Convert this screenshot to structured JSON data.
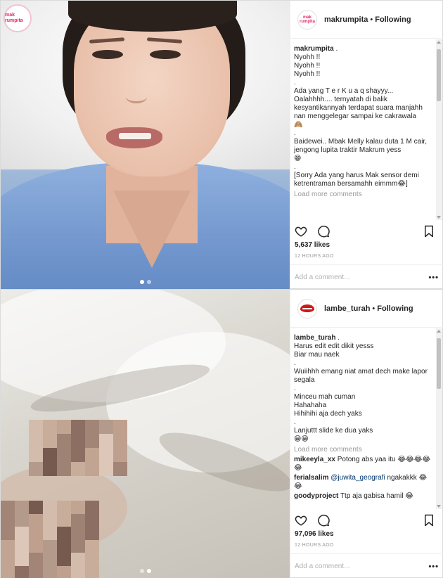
{
  "posts": [
    {
      "media_logo_text": "mak rumpita",
      "avatar_text": "mak rumpita",
      "username": "makrumpita",
      "separator": "•",
      "follow_status": "Following",
      "caption_user": "makrumpita",
      "caption_lines": [
        "Nyohh !!",
        "Nyohh !!",
        "Nyohh !!",
        ".",
        "Ada yang T e r K u a q shayyy...",
        "Oalahhhh.... ternyatah di balik kesyantikannyah terdapat suara manjahh nan menggelegar sampai ke cakrawala",
        "🙈",
        ".",
        "Baidewei.. Mbak Melly kalau duta 1 M cair, jengong lupita traktir Makrum yess",
        "😁",
        ".",
        "[Sorry Ada yang harus Mak sensor demi ketrentraman bersamahh eimmm😂]"
      ],
      "load_more": "Load more comments",
      "comments": [],
      "likes": "5,637 likes",
      "time_ago": "12 HOURS AGO",
      "add_comment_placeholder": "Add a comment...",
      "options_glyph": "•••"
    },
    {
      "username": "lambe_turah",
      "separator": "•",
      "follow_status": "Following",
      "caption_user": "lambe_turah",
      "caption_lines": [
        "Harus edit edit dikit yesss",
        "Biar mau naek",
        ".",
        "Wuiihhh emang niat amat dech make lapor segala",
        ".",
        "Minceu mah cuman",
        "Hahahaha",
        "Hihihihi aja dech yaks",
        ".",
        "Lanjuttt slide ke dua yaks",
        "😁😁"
      ],
      "load_more": "Load more comments",
      "comments": [
        {
          "user": "mikeeyla_xx",
          "text": "Potong abs yaa itu 😂😂😂😂😂"
        },
        {
          "user": "ferialsalim",
          "mention": "@juwita_geografi",
          "text": "ngakakkk 😂😂"
        },
        {
          "user": "goodyproject",
          "text": "Ttp aja gabisa hamil 😂"
        }
      ],
      "likes": "97,096 likes",
      "time_ago": "12 HOURS AGO",
      "add_comment_placeholder": "Add a comment...",
      "options_glyph": "•••"
    }
  ]
}
